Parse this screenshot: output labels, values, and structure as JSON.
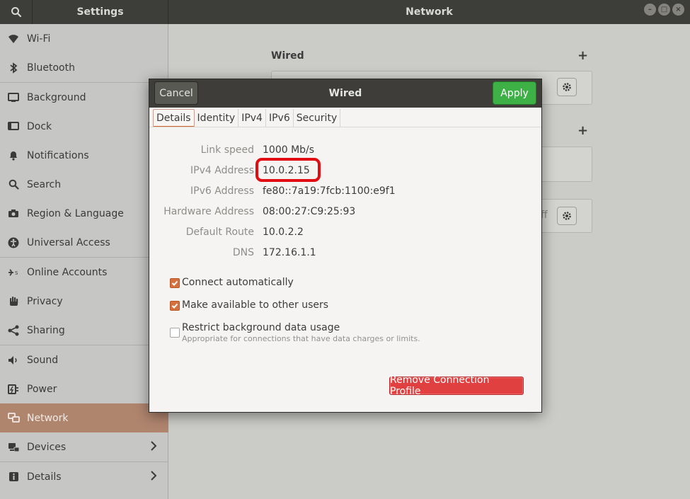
{
  "window": {
    "settings_title": "Settings",
    "panel_title": "Network",
    "controls": [
      "minimize",
      "maximize",
      "close"
    ]
  },
  "sidebar": {
    "items": [
      {
        "label": "Wi-Fi",
        "icon": "wifi-icon"
      },
      {
        "label": "Bluetooth",
        "icon": "bluetooth-icon"
      },
      {
        "label": "Background",
        "icon": "background-icon"
      },
      {
        "label": "Dock",
        "icon": "dock-icon"
      },
      {
        "label": "Notifications",
        "icon": "bell-icon"
      },
      {
        "label": "Search",
        "icon": "search-icon"
      },
      {
        "label": "Region & Language",
        "icon": "camera-icon"
      },
      {
        "label": "Universal Access",
        "icon": "accessibility-icon"
      },
      {
        "label": "Online Accounts",
        "icon": "online-accounts-icon"
      },
      {
        "label": "Privacy",
        "icon": "hand-icon"
      },
      {
        "label": "Sharing",
        "icon": "share-icon"
      },
      {
        "label": "Sound",
        "icon": "speaker-icon"
      },
      {
        "label": "Power",
        "icon": "power-icon"
      },
      {
        "label": "Network",
        "icon": "network-icon",
        "active": true
      },
      {
        "label": "Devices",
        "icon": "devices-icon",
        "chevron": true
      },
      {
        "label": "Details",
        "icon": "info-icon",
        "chevron": true
      }
    ],
    "active_color": "#b0856e"
  },
  "main": {
    "wired_title": "Wired",
    "ghost_off_text": "ff"
  },
  "dialog": {
    "title": "Wired",
    "cancel_label": "Cancel",
    "apply_label": "Apply",
    "apply_color": "#3db046",
    "tabs": [
      {
        "label": "Details",
        "active": true
      },
      {
        "label": "Identity"
      },
      {
        "label": "IPv4"
      },
      {
        "label": "IPv6"
      },
      {
        "label": "Security"
      }
    ],
    "details": [
      {
        "label": "Link speed",
        "value": "1000 Mb/s"
      },
      {
        "label": "IPv4 Address",
        "value": "10.0.2.15"
      },
      {
        "label": "IPv6 Address",
        "value": "fe80::7a19:7fcb:1100:e9f1"
      },
      {
        "label": "Hardware Address",
        "value": "08:00:27:C9:25:93"
      },
      {
        "label": "Default Route",
        "value": "10.0.2.2"
      },
      {
        "label": "DNS",
        "value": "172.16.1.1"
      }
    ],
    "options": [
      {
        "label": "Connect automatically",
        "checked": true
      },
      {
        "label": "Make available to other users",
        "checked": true
      },
      {
        "label": "Restrict background data usage",
        "checked": false,
        "sublabel": "Appropriate for connections that have data charges or limits."
      }
    ],
    "remove_label": "Remove Connection Profile",
    "remove_color": "#e0403f",
    "highlight_color": "#e20d12"
  }
}
